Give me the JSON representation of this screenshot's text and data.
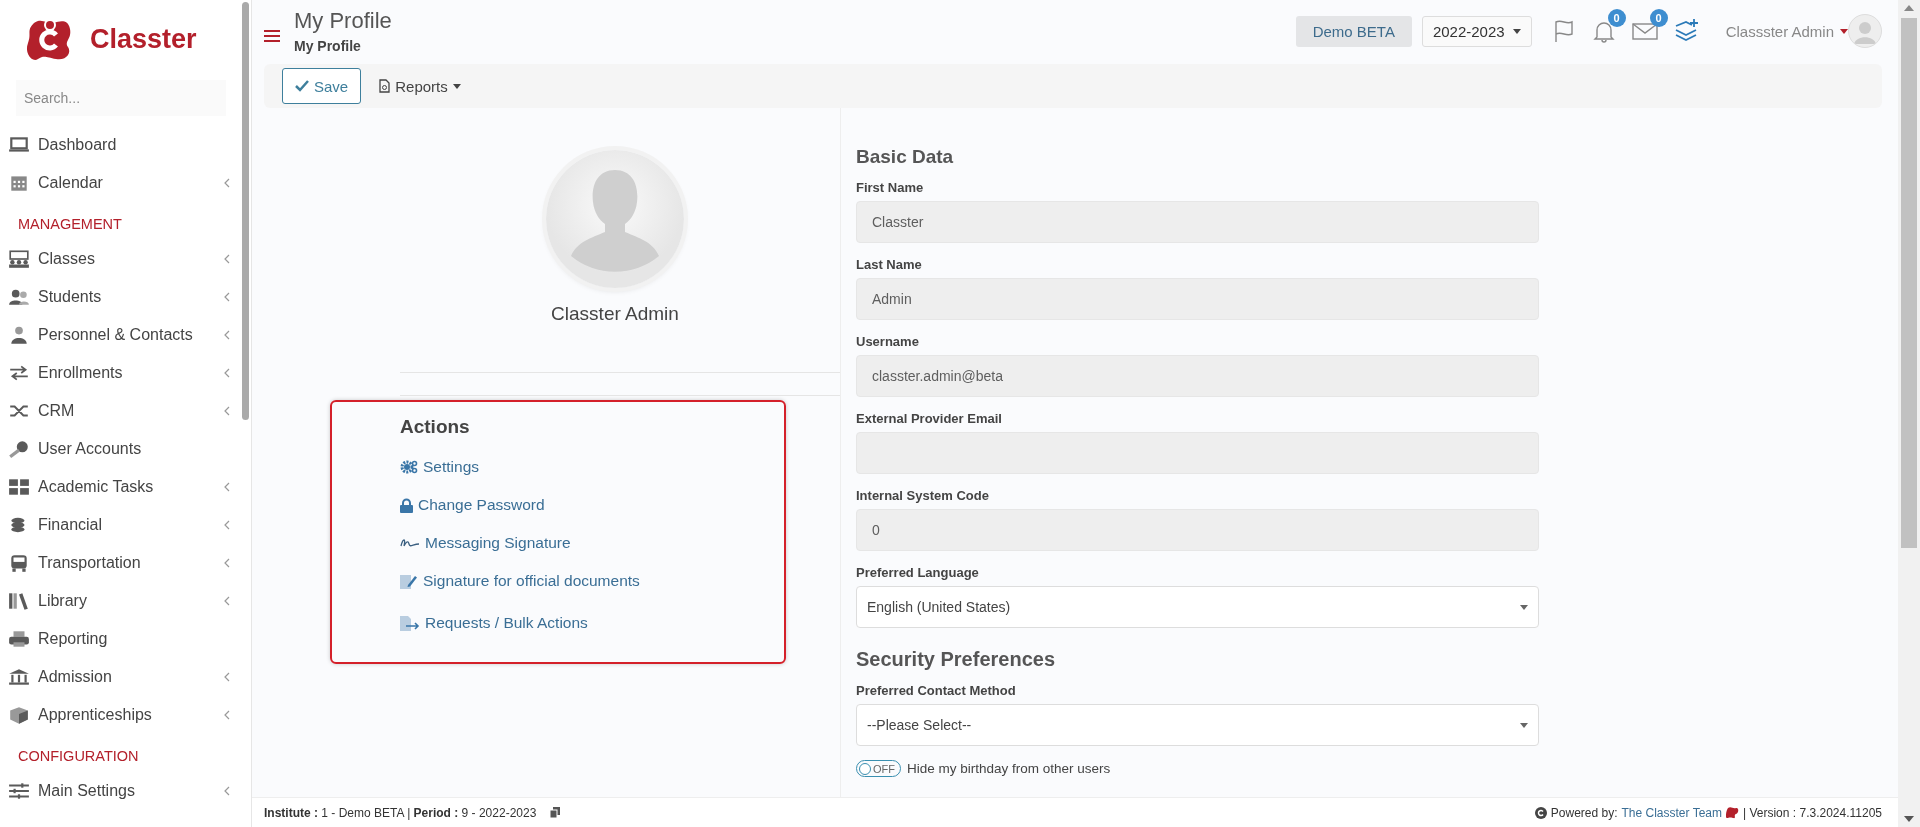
{
  "sidebar": {
    "logo_text": "Classter",
    "search": {
      "placeholder": "Search..."
    },
    "items": [
      {
        "kind": "link",
        "label": "Dashboard",
        "submenu": false
      },
      {
        "kind": "link",
        "label": "Calendar",
        "submenu": true
      },
      {
        "kind": "header",
        "label": "MANAGEMENT"
      },
      {
        "kind": "link",
        "label": "Classes",
        "submenu": true
      },
      {
        "kind": "link",
        "label": "Students",
        "submenu": true
      },
      {
        "kind": "link",
        "label": "Personnel & Contacts",
        "submenu": true
      },
      {
        "kind": "link",
        "label": "Enrollments",
        "submenu": true
      },
      {
        "kind": "link",
        "label": "CRM",
        "submenu": true
      },
      {
        "kind": "link",
        "label": "User Accounts",
        "submenu": false
      },
      {
        "kind": "link",
        "label": "Academic Tasks",
        "submenu": true
      },
      {
        "kind": "link",
        "label": "Financial",
        "submenu": true
      },
      {
        "kind": "link",
        "label": "Transportation",
        "submenu": true
      },
      {
        "kind": "link",
        "label": "Library",
        "submenu": true
      },
      {
        "kind": "link",
        "label": "Reporting",
        "submenu": false
      },
      {
        "kind": "link",
        "label": "Admission",
        "submenu": true
      },
      {
        "kind": "link",
        "label": "Apprenticeships",
        "submenu": true
      },
      {
        "kind": "header",
        "label": "CONFIGURATION"
      },
      {
        "kind": "link",
        "label": "Main Settings",
        "submenu": true
      }
    ]
  },
  "header": {
    "title": "My Profile",
    "breadcrumb": "My Profile",
    "environment": "Demo BETA",
    "school_year": "2022-2023",
    "notifications_count": "0",
    "messages_count": "0",
    "user_name": "Classster Admin"
  },
  "toolbar": {
    "save": "Save",
    "reports": "Reports"
  },
  "profile": {
    "name": "Classter Admin",
    "actions_title": "Actions",
    "actions": [
      "Settings",
      "Change Password",
      "Messaging Signature",
      "Signature for official documents",
      "Requests / Bulk Actions"
    ]
  },
  "form": {
    "sections": [
      {
        "title": "Basic Data",
        "fields": [
          {
            "kind": "text",
            "label": "First Name",
            "value": "Classter"
          },
          {
            "kind": "text",
            "label": "Last Name",
            "value": "Admin"
          },
          {
            "kind": "text",
            "label": "Username",
            "value": "classter.admin@beta"
          },
          {
            "kind": "text",
            "label": "External Provider Email"
          },
          {
            "kind": "text",
            "label": "Internal System Code",
            "value": "0"
          },
          {
            "kind": "select",
            "label": "Preferred Language",
            "value": "English (United States)"
          }
        ]
      },
      {
        "title": "Security Preferences",
        "fields": [
          {
            "kind": "select",
            "label": "Preferred Contact Method",
            "value": "--Please Select--"
          }
        ]
      }
    ],
    "toggle": {
      "on": false,
      "state_text": "OFF",
      "label": "Hide my birthday from other users"
    }
  },
  "footer": {
    "context": "**Institute :** 1 - Demo BETA | **Period :** 9 - 2022-2023",
    "powered_by": "Powered by:",
    "team_link": "The Classter Team",
    "version": "| Version : 7.3.2024.11205"
  }
}
